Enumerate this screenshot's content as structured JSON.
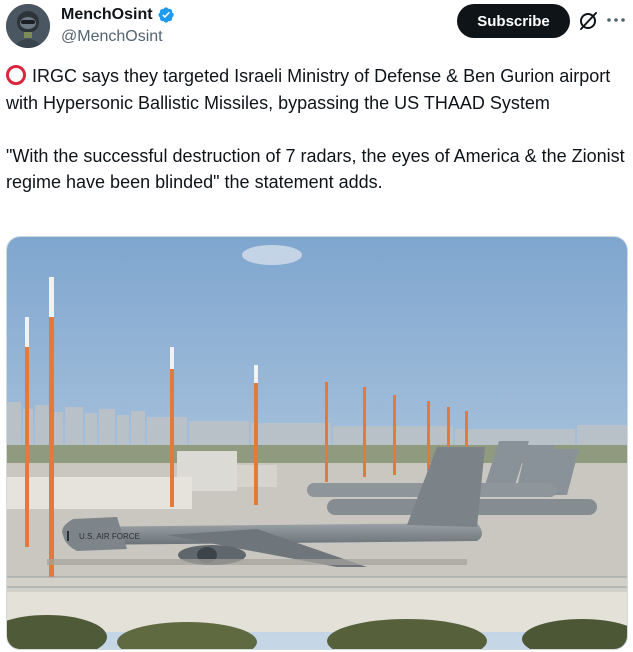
{
  "author": {
    "display_name": "MenchOsint",
    "handle": "@MenchOsint",
    "verified": true
  },
  "actions": {
    "subscribe_label": "Subscribe",
    "grok_icon": "grok-icon",
    "more_icon": "more-icon"
  },
  "tweet": {
    "line1_icon": "red-circle-icon",
    "paragraph1": "IRGC says they targeted Israeli Ministry of Defense & Ben Gurion airport with Hypersonic Ballistic Missiles, bypassing the US THAAD System",
    "paragraph2": "\"With the successful destruction of 7 radars, the eyes of America & the Zionist regime have been blinded\" the statement adds."
  },
  "media": {
    "fuselage_text": "U.S. AIR FORCE"
  },
  "colors": {
    "text": "#0f1419",
    "secondary": "#536471",
    "verified": "#1d9bf0",
    "accent_red": "#d7263d",
    "button_bg": "#0f1419"
  }
}
